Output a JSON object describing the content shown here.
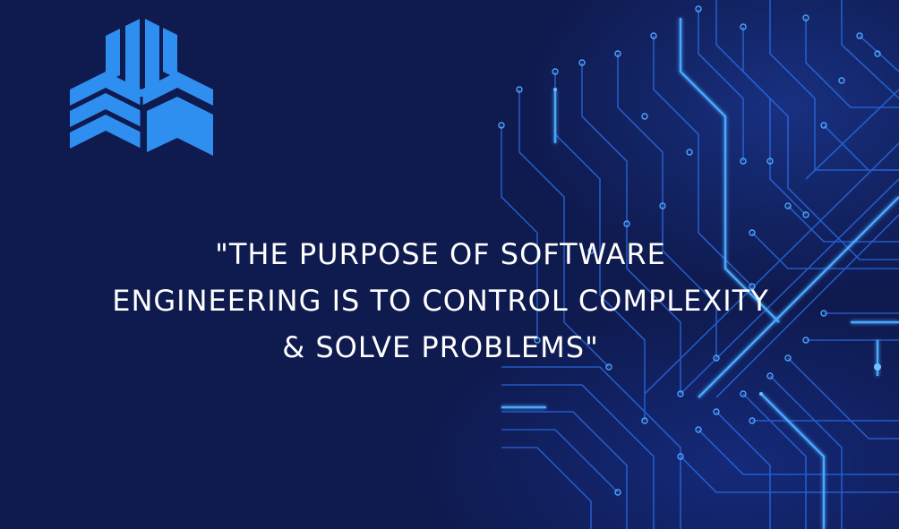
{
  "logo": {
    "icon": "cube-logo-icon",
    "color": "#2f8ff0"
  },
  "quote": {
    "lines": [
      "\"THE PURPOSE OF SOFTWARE",
      "ENGINEERING IS TO CONTROL COMPLEXITY",
      "& SOLVE PROBLEMS\""
    ]
  },
  "colors": {
    "background": "#0f1a4f",
    "circuit": "#2a7bff",
    "text": "#ffffff"
  }
}
